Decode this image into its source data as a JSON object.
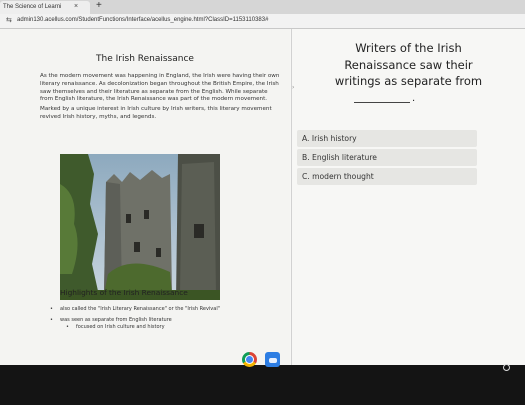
{
  "browser": {
    "tab_title": "The Science of Learni",
    "tab_close": "×",
    "new_tab": "+",
    "url": "admin130.acellus.com/StudentFunctions/Interface/acellus_engine.html?ClassID=1153110383#"
  },
  "reading": {
    "title": "The Irish Renaissance",
    "paragraphs": [
      "As the modern movement was happening in England, the Irish were having their own literary renaissance. As decolonization began throughout the British Empire, the Irish saw themselves and their literature as separate from the English. While separate from English literature, the Irish Renaissance was part of the modern movement.",
      "Marked by a unique interest in Irish culture by Irish writers, this literary movement revived Irish history, myths, and legends."
    ],
    "image_name": "castle-photo",
    "highlights_title": "Highlights of the Irish Renaissance",
    "highlights": [
      "also called the \"Irish Literary Renaissance\" or the \"Irish Revival\"",
      "was seen as separate from English literature",
      "focused on Irish culture and history"
    ]
  },
  "question": {
    "line1": "Writers of the Irish",
    "line2": "Renaissance saw their",
    "line3": "writings as separate from",
    "blank_period": ".",
    "choices": [
      {
        "letter": "A.",
        "text": "Irish history"
      },
      {
        "letter": "B.",
        "text": "English literature"
      },
      {
        "letter": "C.",
        "text": "modern thought"
      }
    ]
  },
  "taskbar": {
    "icons": [
      "chrome-icon",
      "files-icon",
      "status-icon"
    ]
  }
}
